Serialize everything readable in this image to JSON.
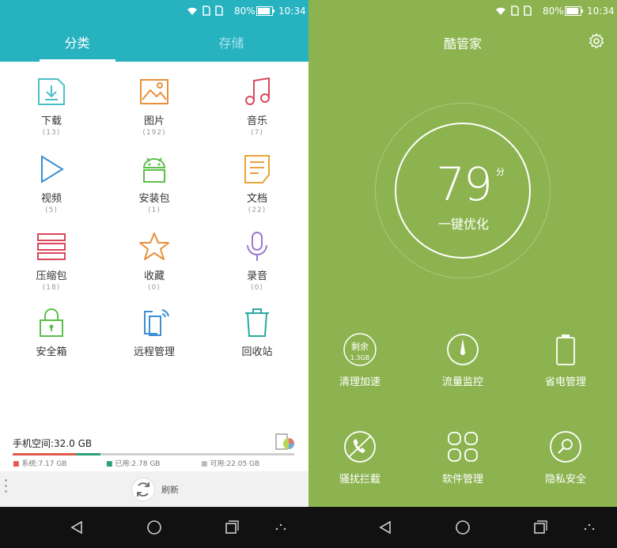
{
  "status": {
    "battery": "80%",
    "time": "10:34"
  },
  "file_manager": {
    "tabs": [
      {
        "label": "分类"
      },
      {
        "label": "存储"
      }
    ],
    "categories": [
      {
        "label": "下载",
        "count": "(13)",
        "icon": "download-icon",
        "color": "#4bbfc9"
      },
      {
        "label": "图片",
        "count": "(192)",
        "icon": "image-icon",
        "color": "#e8903a"
      },
      {
        "label": "音乐",
        "count": "(7)",
        "icon": "music-icon",
        "color": "#d9475a"
      },
      {
        "label": "视频",
        "count": "(5)",
        "icon": "video-play-icon",
        "color": "#3c8fd6"
      },
      {
        "label": "安装包",
        "count": "(1)",
        "icon": "android-icon",
        "color": "#5cbf4a"
      },
      {
        "label": "文档",
        "count": "(22)",
        "icon": "document-icon",
        "color": "#e8a33a"
      },
      {
        "label": "压缩包",
        "count": "(18)",
        "icon": "archive-icon",
        "color": "#d9475a"
      },
      {
        "label": "收藏",
        "count": "(0)",
        "icon": "star-icon",
        "color": "#e8903a"
      },
      {
        "label": "录音",
        "count": "(0)",
        "icon": "microphone-icon",
        "color": "#9a7bd0"
      },
      {
        "label": "安全箱",
        "count": "",
        "icon": "lock-icon",
        "color": "#5cbf4a"
      },
      {
        "label": "远程管理",
        "count": "",
        "icon": "remote-icon",
        "color": "#3c8fd6"
      },
      {
        "label": "回收站",
        "count": "",
        "icon": "trash-icon",
        "color": "#2aa8a0"
      }
    ],
    "storage": {
      "title": "手机空间:32.0 GB",
      "system": "系统:7.17 GB",
      "used": "已用:2.78 GB",
      "free": "可用:22.05 GB",
      "system_fraction": 0.224,
      "used_fraction": 0.087,
      "colors": {
        "system": "#e05a4c",
        "used": "#2aa277",
        "free": "#cfcfcf"
      }
    },
    "refresh_label": "刷新"
  },
  "manager": {
    "title": "酷管家",
    "score": "79",
    "score_unit": "分",
    "action": "一键优化",
    "functions": [
      {
        "label": "清理加速",
        "icon": "clean-icon",
        "badge_top": "剩余",
        "badge_bottom": "1.3GB"
      },
      {
        "label": "流量监控",
        "icon": "gauge-icon"
      },
      {
        "label": "省电管理",
        "icon": "battery-icon"
      },
      {
        "label": "骚扰拦截",
        "icon": "phone-block-icon"
      },
      {
        "label": "软件管理",
        "icon": "apps-icon"
      },
      {
        "label": "隐私安全",
        "icon": "privacy-icon"
      }
    ],
    "accent": "#8cb34f"
  },
  "colors": {
    "header": "#27b2c0"
  }
}
